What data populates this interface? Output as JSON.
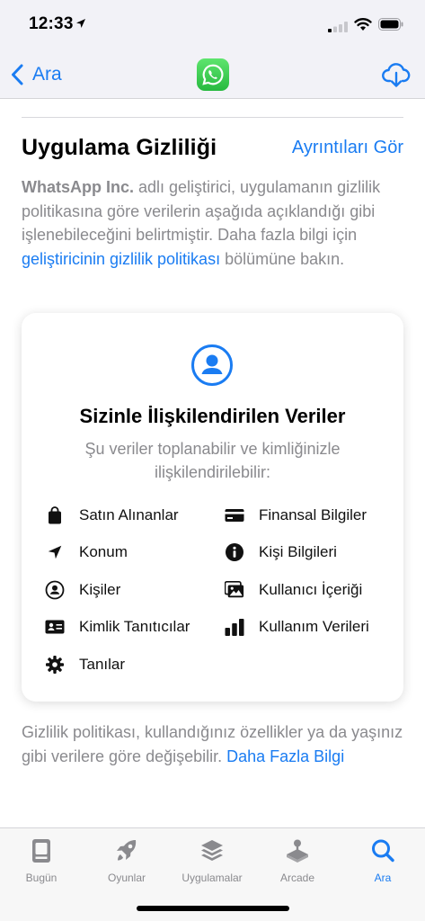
{
  "status_bar": {
    "time": "12:33"
  },
  "nav": {
    "back_label": "Ara"
  },
  "section": {
    "title": "Uygulama Gizliliği",
    "details_link": "Ayrıntıları Gör",
    "description": {
      "developer": "WhatsApp Inc.",
      "text1": " adlı geliştirici, uygulamanın gizlilik politikasına göre verilerin aşağıda açıklandığı gibi işlenebileceğini belirtmiştir. Daha fazla bilgi için ",
      "link": "geliştiricinin gizlilik politikası",
      "text2": " bölümüne bakın."
    }
  },
  "card": {
    "title": "Sizinle İlişkilendirilen Veriler",
    "subtitle": "Şu veriler toplanabilir ve kimliğinizle ilişkilendirilebilir:",
    "items": [
      {
        "label": "Satın Alınanlar",
        "icon": "shopping-bag-icon"
      },
      {
        "label": "Finansal Bilgiler",
        "icon": "credit-card-icon"
      },
      {
        "label": "Konum",
        "icon": "location-arrow-icon"
      },
      {
        "label": "Kişi Bilgileri",
        "icon": "info-icon"
      },
      {
        "label": "Kişiler",
        "icon": "person-circle-icon"
      },
      {
        "label": "Kullanıcı İçeriği",
        "icon": "photos-icon"
      },
      {
        "label": "Kimlik Tanıtıcılar",
        "icon": "id-card-icon"
      },
      {
        "label": "Kullanım Verileri",
        "icon": "bar-chart-icon"
      },
      {
        "label": "Tanılar",
        "icon": "gear-icon"
      }
    ]
  },
  "footer": {
    "text": "Gizlilik politikası, kullandığınız özellikler ya da yaşınız gibi verilere göre değişebilir. ",
    "link": "Daha Fazla Bilgi"
  },
  "tabs": [
    {
      "label": "Bugün",
      "icon": "today-icon",
      "active": false
    },
    {
      "label": "Oyunlar",
      "icon": "rocket-icon",
      "active": false
    },
    {
      "label": "Uygulamalar",
      "icon": "apps-stack-icon",
      "active": false
    },
    {
      "label": "Arcade",
      "icon": "arcade-icon",
      "active": false
    },
    {
      "label": "Ara",
      "icon": "search-icon",
      "active": true
    }
  ],
  "colors": {
    "accent": "#1a7cf2",
    "secondary_text": "#8a8a8e",
    "app_icon_green": "#27b93f"
  }
}
